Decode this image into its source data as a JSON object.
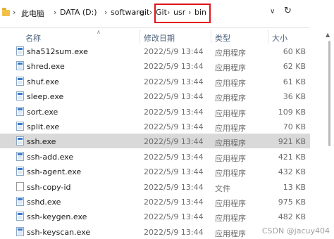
{
  "address_bar": {
    "breadcrumbs": [
      "此电脑",
      "DATA (D:)",
      "software",
      "git",
      "Git",
      "usr",
      "bin"
    ]
  },
  "columns": {
    "name": "名称",
    "date_modified": "修改日期",
    "type": "类型",
    "size": "大小"
  },
  "files": [
    {
      "name": "sha512sum.exe",
      "date": "2022/5/9 13:44",
      "type": "应用程序",
      "size": "60 KB",
      "icon": "exe-icon",
      "selected": false
    },
    {
      "name": "shred.exe",
      "date": "2022/5/9 13:44",
      "type": "应用程序",
      "size": "62 KB",
      "icon": "exe-icon",
      "selected": false
    },
    {
      "name": "shuf.exe",
      "date": "2022/5/9 13:44",
      "type": "应用程序",
      "size": "61 KB",
      "icon": "exe-icon",
      "selected": false
    },
    {
      "name": "sleep.exe",
      "date": "2022/5/9 13:44",
      "type": "应用程序",
      "size": "36 KB",
      "icon": "exe-icon",
      "selected": false
    },
    {
      "name": "sort.exe",
      "date": "2022/5/9 13:44",
      "type": "应用程序",
      "size": "109 KB",
      "icon": "exe-icon",
      "selected": false
    },
    {
      "name": "split.exe",
      "date": "2022/5/9 13:44",
      "type": "应用程序",
      "size": "70 KB",
      "icon": "exe-icon",
      "selected": false
    },
    {
      "name": "ssh.exe",
      "date": "2022/5/9 13:44",
      "type": "应用程序",
      "size": "921 KB",
      "icon": "exe-icon",
      "selected": true
    },
    {
      "name": "ssh-add.exe",
      "date": "2022/5/9 13:44",
      "type": "应用程序",
      "size": "421 KB",
      "icon": "exe-icon",
      "selected": false
    },
    {
      "name": "ssh-agent.exe",
      "date": "2022/5/9 13:44",
      "type": "应用程序",
      "size": "432 KB",
      "icon": "exe-icon",
      "selected": false
    },
    {
      "name": "ssh-copy-id",
      "date": "2022/5/9 13:44",
      "type": "文件",
      "size": "13 KB",
      "icon": "file-icon",
      "selected": false
    },
    {
      "name": "sshd.exe",
      "date": "2022/5/9 13:44",
      "type": "应用程序",
      "size": "975 KB",
      "icon": "exe-icon",
      "selected": false
    },
    {
      "name": "ssh-keygen.exe",
      "date": "2022/5/9 13:44",
      "type": "应用程序",
      "size": "482 KB",
      "icon": "exe-icon",
      "selected": false
    },
    {
      "name": "ssh-keyscan.exe",
      "date": "2022/5/9 13:44",
      "type": "应用程序",
      "size": "",
      "icon": "exe-icon",
      "selected": false
    }
  ],
  "watermark": "CSDN @jacuy404",
  "colors": {
    "selection": "#d9d9d9",
    "highlight_box": "#e0141a",
    "header_text": "#4c607a"
  }
}
